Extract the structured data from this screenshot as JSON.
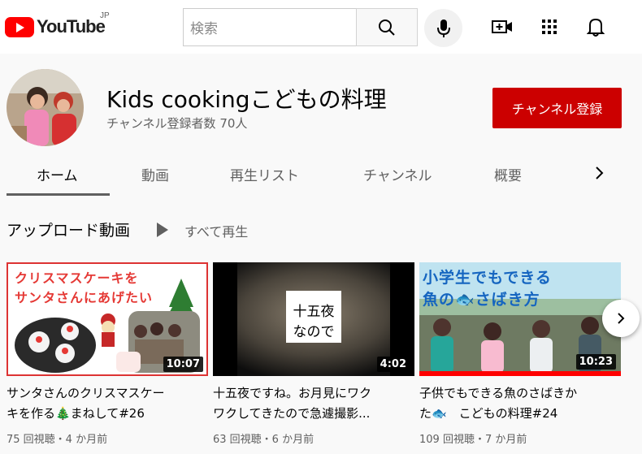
{
  "masthead": {
    "logo_text": "YouTube",
    "logo_region": "JP",
    "search_placeholder": "検索"
  },
  "channel": {
    "name": "Kids cookingこどもの料理",
    "subscribers": "チャンネル登録者数 70人",
    "subscribe_label": "チャンネル登録"
  },
  "tabs": [
    {
      "label": "ホーム",
      "active": true
    },
    {
      "label": "動画",
      "active": false
    },
    {
      "label": "再生リスト",
      "active": false
    },
    {
      "label": "チャンネル",
      "active": false
    },
    {
      "label": "概要",
      "active": false
    }
  ],
  "shelf": {
    "title": "アップロード動画",
    "play_all": "すべて再生"
  },
  "videos": [
    {
      "thumb_text_line1": "クリスマスケーキを",
      "thumb_text_line2": "サンタさんにあげたい",
      "duration": "10:07",
      "title_line1": "サンタさんのクリスマスケー",
      "title_line2": "キを作る🎄まねして#26",
      "meta": "75 回視聴・4 か月前"
    },
    {
      "thumb_text_line1": "十五夜",
      "thumb_text_line2": "なので",
      "duration": "4:02",
      "title_line1": "十五夜ですね。お月見にワク",
      "title_line2": "ワクしてきたので急遽撮影...",
      "meta": "63 回視聴・6 か月前"
    },
    {
      "thumb_text_line1": "小学生でもできる",
      "thumb_text_line2": "魚の🐟さばき方",
      "duration": "10:23",
      "title_line1": "子供でもできる魚のさばきか",
      "title_line2": "た🐟　こどもの料理#24",
      "meta": "109 回視聴・7 か月前"
    }
  ],
  "colors": {
    "brand_red": "#ff0000",
    "subscribe_red": "#cc0000",
    "progress_red": "#ff0000"
  }
}
